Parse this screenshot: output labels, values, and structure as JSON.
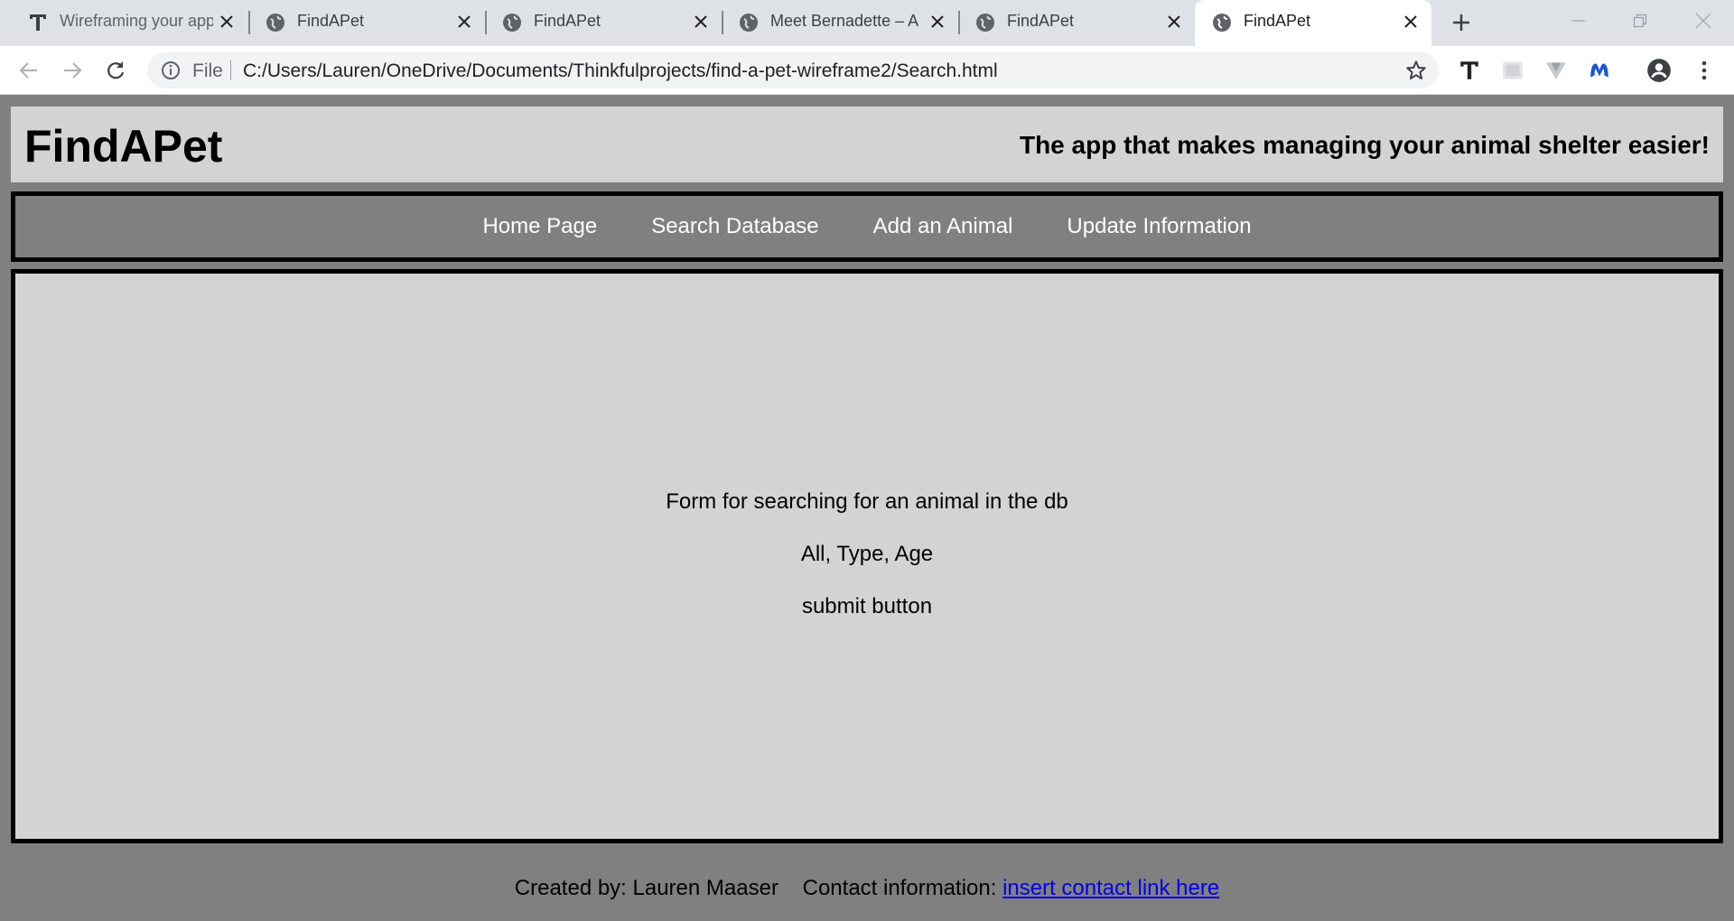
{
  "browser": {
    "tabs": [
      {
        "title": "Wireframing your app",
        "icon": "thinkful-icon",
        "active": false
      },
      {
        "title": "FindAPet",
        "icon": "globe-icon",
        "active": false
      },
      {
        "title": "FindAPet",
        "icon": "globe-icon",
        "active": false
      },
      {
        "title": "Meet Bernadette – A",
        "icon": "globe-icon",
        "active": false
      },
      {
        "title": "FindAPet",
        "icon": "globe-icon",
        "active": false
      },
      {
        "title": "FindAPet",
        "icon": "globe-icon",
        "active": true
      }
    ],
    "address_bar": {
      "scheme_label": "File",
      "url": "C:/Users/Lauren/OneDrive/Documents/Thinkfulprojects/find-a-pet-wireframe2/Search.html"
    },
    "extensions": [
      "thinkful-icon",
      "extension-puzzle-icon",
      "vuetify-icon",
      "malwarebytes-icon"
    ]
  },
  "header": {
    "title": "FindAPet",
    "tagline": "The app that makes managing your animal shelter easier!"
  },
  "nav": {
    "items": [
      {
        "label": "Home Page"
      },
      {
        "label": "Search Database"
      },
      {
        "label": "Add an Animal"
      },
      {
        "label": "Update Information"
      }
    ]
  },
  "main": {
    "lines": [
      "Form for searching for an animal in the db",
      "All, Type, Age",
      "submit button"
    ]
  },
  "footer": {
    "created_by": "Created by: Lauren Maaser",
    "contact_label": "Contact information:",
    "contact_link": "insert contact link here"
  },
  "colors": {
    "page_background": "#808080",
    "panel_background": "#d3d3d3",
    "border": "#000000",
    "nav_text": "#ffffff",
    "link": "#0000ee"
  }
}
